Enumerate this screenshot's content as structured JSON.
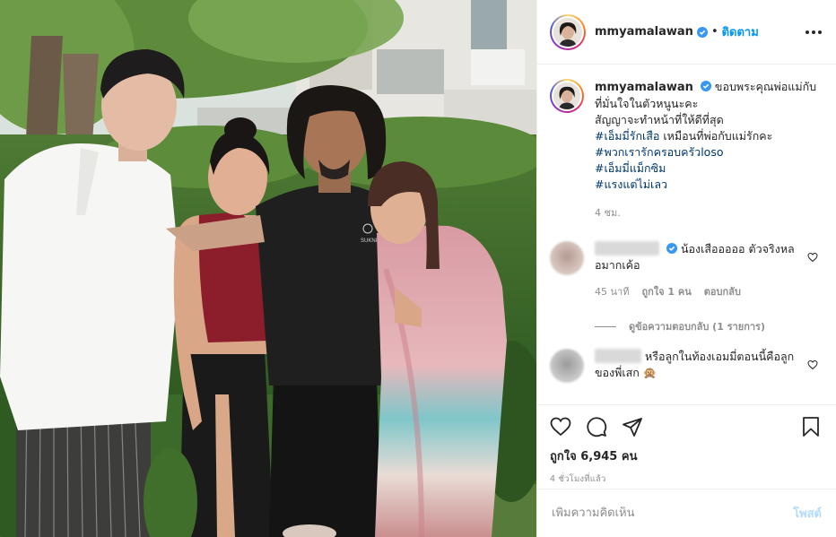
{
  "header": {
    "username": "mmyamalawan",
    "separator": "•",
    "follow_label": "ติดตาม"
  },
  "caption": {
    "username": "mmyamalawan",
    "text_lines": [
      "ขอบพระคุณพ่อแม่กับที่มั่นใจในตัวหนูนะคะ",
      "สัญญาจะทำหน้าที่ให้ดีที่สุด"
    ],
    "hashtag_1": "#เอ็มมี่รักเสือ",
    "hashtag_1_suffix": " เหมือนที่พ่อกับแม่รักคะ",
    "hashtags": [
      "#พวกเรารักครอบครัวloso",
      "#เอ็มมี่แม็กซิม",
      "#แรงแต่ไม่เลว"
    ],
    "time": "4 ชม."
  },
  "comments": [
    {
      "text": "น้องเสือออออ ตัวจริงหลอมากเค้อ",
      "time": "45 นาที",
      "likes": "ถูกใจ 1 คน",
      "reply_label": "ตอบกลับ",
      "view_replies": "ดูข้อความตอบกลับ (1 รายการ)"
    },
    {
      "text": "หรือลูกในท้องเอมมี่ตอนนี้คือลูกของพี่เสก 🙊"
    }
  ],
  "actions": {
    "likes": "ถูกใจ 6,945 คน",
    "time_ago": "4 ชั่วโมงที่แล้ว"
  },
  "add_comment": {
    "placeholder": "เพิ่มความคิดเห็น",
    "post_label": "โพสต์"
  },
  "photo": {
    "shirt_logo": "SUKNIYOM"
  },
  "colors": {
    "link_blue": "#0095f6",
    "hashtag_blue": "#00376b",
    "post_disabled": "#b3dbff",
    "verified_blue": "#3897f0",
    "muted": "#8e8e8e"
  },
  "icons": [
    "verified-icon",
    "more-icon",
    "heart-icon",
    "comment-icon",
    "share-icon",
    "bookmark-icon"
  ]
}
